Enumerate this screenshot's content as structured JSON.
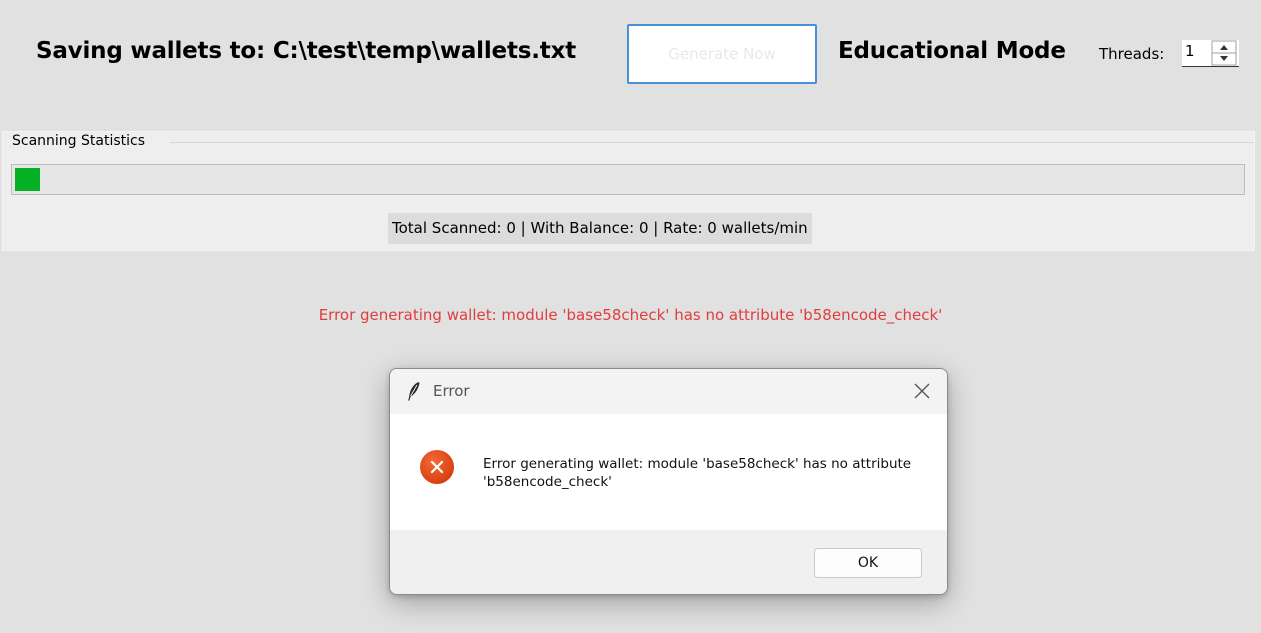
{
  "header": {
    "save_path": "Saving wallets to: C:\\test\\temp\\wallets.txt",
    "generate_button_label": "Generate Now",
    "mode_label": "Educational Mode",
    "threads_label": "Threads:",
    "threads_value": "1"
  },
  "stats": {
    "frame_title": "Scanning Statistics",
    "progress_fraction": 0.02,
    "summary": "Total Scanned: 0 | With Balance: 0 | Rate: 0 wallets/min"
  },
  "status": {
    "error_text": "Error generating wallet: module 'base58check' has no attribute 'b58encode_check'"
  },
  "dialog": {
    "title": "Error",
    "message": "Error generating wallet: module 'base58check' has no attribute 'b58encode_check'",
    "ok_label": "OK",
    "icon": "error-icon"
  },
  "colors": {
    "background": "#e1e1e1",
    "progress_green": "#06b025",
    "error_red": "#e03e3e",
    "dialog_icon_orange": "#d7410f",
    "button_focus_blue": "#4a90d9"
  }
}
